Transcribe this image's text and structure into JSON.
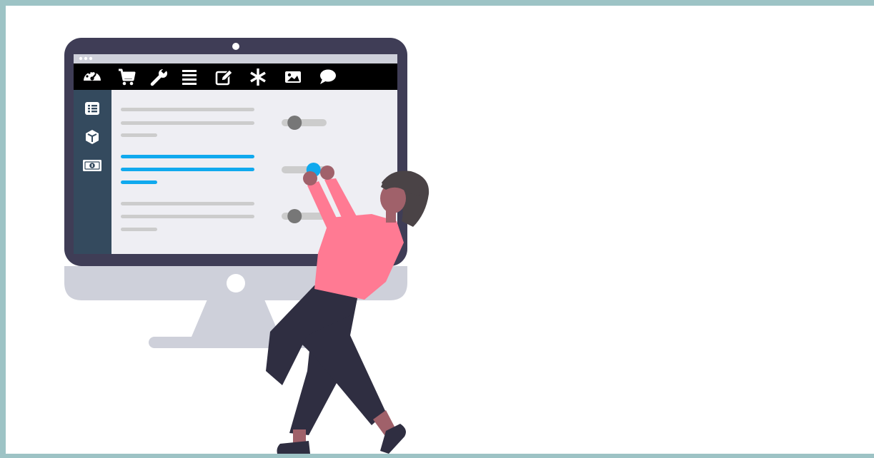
{
  "illustration": {
    "subject": "person-adjusting-settings-on-monitor",
    "colors": {
      "frame": "#9dc3c5",
      "monitor_bezel": "#3f3d56",
      "monitor_chin": "#ced0da",
      "screen_bg": "#eeeef3",
      "toolbar": "#000000",
      "sidebar": "#344a5e",
      "placeholder_line": "#cccccc",
      "highlight": "#10a9ee",
      "slider_knob": "#777777",
      "shirt": "#ff7a93",
      "pants": "#2f2e41",
      "hair": "#4a4346",
      "skin": "#a0616a"
    },
    "toolbar_icons": [
      "dashboard-icon",
      "cart-icon",
      "wrench-icon",
      "list-icon",
      "edit-icon",
      "asterisk-icon",
      "image-icon",
      "comment-icon"
    ],
    "sidebar_icons": [
      "list-alt-icon",
      "cube-icon",
      "money-bill-icon"
    ],
    "sliders": [
      {
        "name": "slider-1",
        "value": 0.25,
        "active": false
      },
      {
        "name": "slider-2",
        "value": 0.75,
        "active": true
      },
      {
        "name": "slider-3",
        "value": 0.25,
        "active": false
      }
    ]
  }
}
